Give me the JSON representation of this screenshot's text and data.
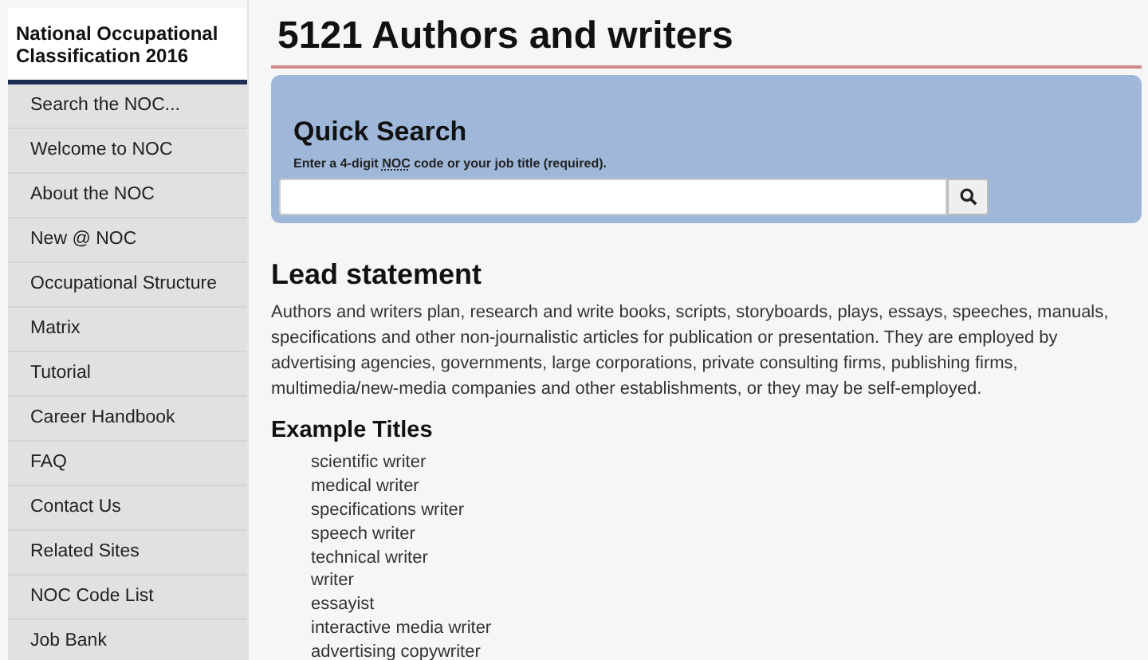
{
  "sidebar": {
    "title": "National Occupational Classification 2016",
    "items": [
      {
        "label": "Search the NOC..."
      },
      {
        "label": "Welcome to NOC"
      },
      {
        "label": "About the NOC"
      },
      {
        "label": "New @ NOC"
      },
      {
        "label": "Occupational Structure"
      },
      {
        "label": "Matrix"
      },
      {
        "label": "Tutorial"
      },
      {
        "label": "Career Handbook"
      },
      {
        "label": "FAQ"
      },
      {
        "label": "Contact Us"
      },
      {
        "label": "Related Sites"
      },
      {
        "label": "NOC Code List"
      },
      {
        "label": "Job Bank"
      }
    ]
  },
  "page_title": "5121 Authors and writers",
  "quick_search": {
    "title": "Quick Search",
    "hint_before": "Enter a 4-digit ",
    "hint_abbr": "NOC",
    "hint_after": " code or your job title (required)."
  },
  "lead_statement": {
    "heading": "Lead statement",
    "text": "Authors and writers plan, research and write books, scripts, storyboards, plays, essays, speeches, manuals, specifications and other non-journalistic articles for publication or presentation. They are employed by advertising agencies, governments, large corporations, private consulting firms, publishing firms, multimedia/new-media companies and other establishments, or they may be self-employed."
  },
  "example_titles": {
    "heading": "Example Titles",
    "items": [
      "scientific writer",
      "medical writer",
      "specifications writer",
      "speech writer",
      "technical writer",
      "writer",
      "essayist",
      "interactive media writer",
      "advertising copywriter"
    ]
  }
}
